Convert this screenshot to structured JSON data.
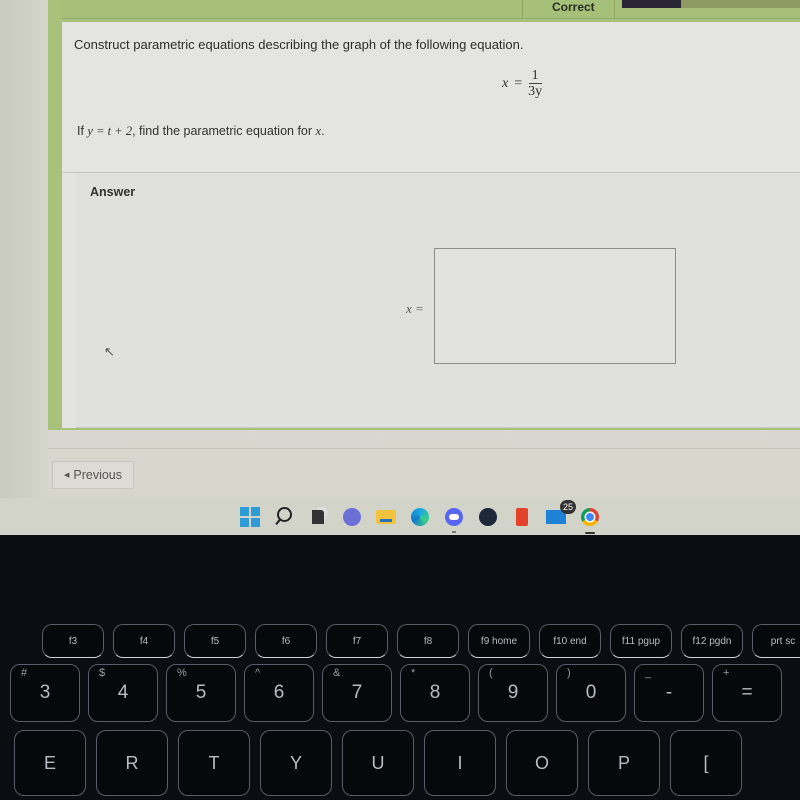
{
  "header": {
    "status_label": "Correct",
    "progress_fraction": 0.33
  },
  "question": {
    "prompt": "Construct parametric equations describing the graph of the following equation.",
    "equation": {
      "lhs": "x",
      "equals": "=",
      "numerator": "1",
      "denominator": "3y"
    },
    "given": {
      "prefix": "If ",
      "math": "y = t + 2",
      "suffix": ", find the parametric equation for ",
      "var": "x",
      "end": "."
    }
  },
  "answer": {
    "section_label": "Answer",
    "input_label": "x =",
    "input_value": ""
  },
  "nav": {
    "previous_label": "Previous"
  },
  "taskbar": {
    "icons": [
      {
        "name": "windows-start-icon"
      },
      {
        "name": "search-icon"
      },
      {
        "name": "widgets-icon"
      },
      {
        "name": "teams-chat-icon"
      },
      {
        "name": "file-explorer-icon"
      },
      {
        "name": "edge-browser-icon"
      },
      {
        "name": "discord-icon"
      },
      {
        "name": "steam-icon"
      },
      {
        "name": "office-icon"
      },
      {
        "name": "mail-icon",
        "badge": "25"
      },
      {
        "name": "chrome-icon"
      }
    ]
  },
  "keyboard": {
    "function_row": [
      "f3",
      "f4",
      "f5",
      "f6",
      "f7",
      "f8",
      "f9 home",
      "f10 end",
      "f11 pgup",
      "f12 pgdn",
      "prt sc"
    ],
    "number_row": [
      {
        "shift": "#",
        "main": "3"
      },
      {
        "shift": "$",
        "main": "4"
      },
      {
        "shift": "%",
        "main": "5"
      },
      {
        "shift": "^",
        "main": "6"
      },
      {
        "shift": "&",
        "main": "7"
      },
      {
        "shift": "*",
        "main": "8"
      },
      {
        "shift": "(",
        "main": "9"
      },
      {
        "shift": ")",
        "main": "0"
      },
      {
        "shift": "_",
        "main": "-"
      },
      {
        "shift": "+",
        "main": "="
      }
    ],
    "letter_row": [
      "E",
      "R",
      "T",
      "Y",
      "U",
      "I",
      "O",
      "P",
      "["
    ]
  }
}
